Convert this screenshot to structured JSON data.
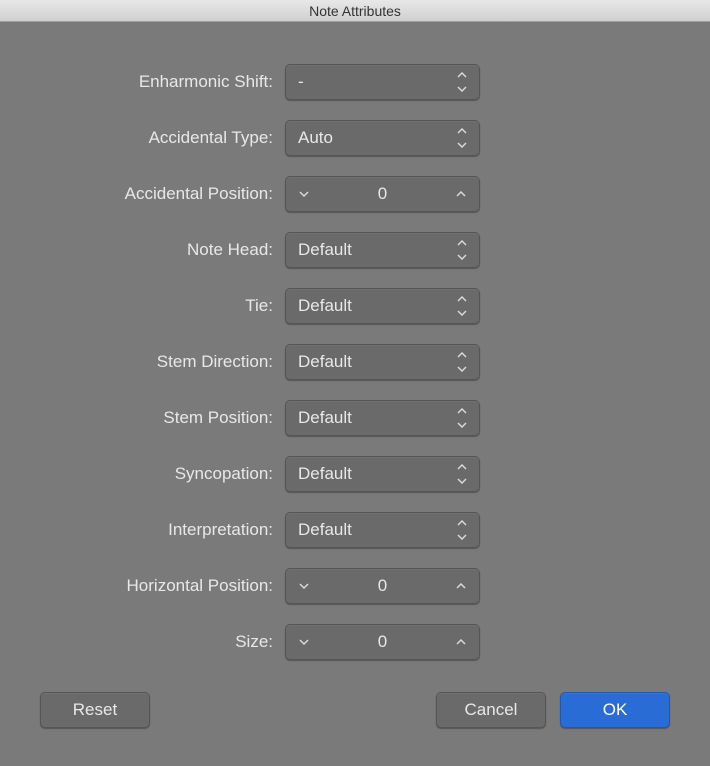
{
  "window": {
    "title": "Note Attributes"
  },
  "fields": {
    "enharmonic_shift": {
      "label": "Enharmonic Shift:",
      "value": "-",
      "type": "select"
    },
    "accidental_type": {
      "label": "Accidental Type:",
      "value": "Auto",
      "type": "select"
    },
    "accidental_position": {
      "label": "Accidental Position:",
      "value": "0",
      "type": "stepper"
    },
    "note_head": {
      "label": "Note Head:",
      "value": "Default",
      "type": "select"
    },
    "tie": {
      "label": "Tie:",
      "value": "Default",
      "type": "select"
    },
    "stem_direction": {
      "label": "Stem Direction:",
      "value": "Default",
      "type": "select"
    },
    "stem_position": {
      "label": "Stem Position:",
      "value": "Default",
      "type": "select"
    },
    "syncopation": {
      "label": "Syncopation:",
      "value": "Default",
      "type": "select"
    },
    "interpretation": {
      "label": "Interpretation:",
      "value": "Default",
      "type": "select"
    },
    "horizontal_position": {
      "label": "Horizontal Position:",
      "value": "0",
      "type": "stepper"
    },
    "size": {
      "label": "Size:",
      "value": "0",
      "type": "stepper"
    }
  },
  "buttons": {
    "reset": "Reset",
    "cancel": "Cancel",
    "ok": "OK"
  }
}
